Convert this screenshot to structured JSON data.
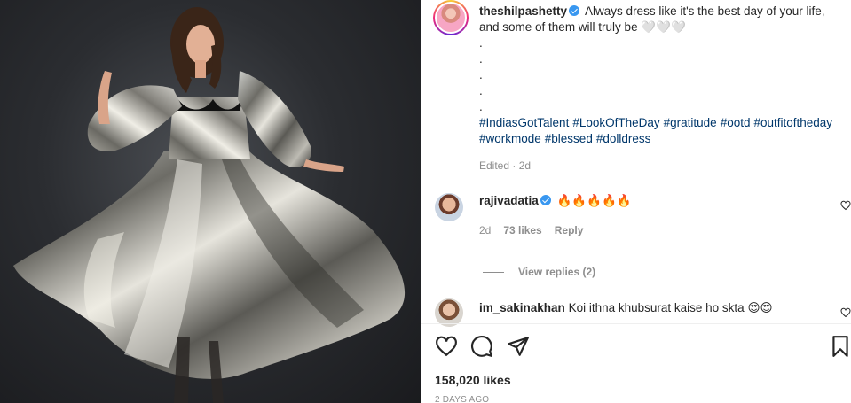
{
  "post": {
    "image_alt": "Woman in metallic silver flared dress",
    "author": {
      "username": "theshilpashetty",
      "verified": true
    },
    "caption": {
      "text": "Always dress like it's the best day of your life, and some of them will truly be 🤍🤍🤍",
      "dots": [
        ".",
        ".",
        ".",
        ".",
        "."
      ],
      "hashtags": [
        "#IndiasGotTalent",
        "#LookOfTheDay",
        "#gratitude",
        "#ootd",
        "#outfitoftheday",
        "#workmode",
        "#blessed",
        "#dolldress"
      ]
    },
    "edited_label": "Edited · 2d"
  },
  "comments": [
    {
      "username": "rajivadatia",
      "verified": true,
      "text": "🔥🔥🔥🔥🔥",
      "age": "2d",
      "likes": "73 likes",
      "reply_label": "Reply"
    },
    {
      "username": "im_sakinakhan",
      "verified": false,
      "text": "Koi ithna khubsurat kaise ho skta 😍😍"
    }
  ],
  "view_replies": "View replies (2)",
  "actions": {
    "like": "heart-icon",
    "comment": "comment-bubble-icon",
    "share": "paper-plane-icon",
    "save": "bookmark-icon"
  },
  "likes_count": "158,020 likes",
  "time_ago": "2 DAYS AGO",
  "colors": {
    "link": "#00376b",
    "verified": "#3897f0",
    "muted": "#8e8e8e"
  }
}
